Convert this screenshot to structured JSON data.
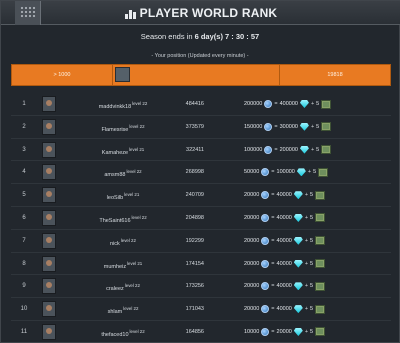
{
  "title": "PLAYER WORLD RANK",
  "season": {
    "prefix": "Season ends in",
    "countdown": "6 day(s) 7 : 30 : 57"
  },
  "position_note": "- Your position (Updated every minute) -",
  "my_entry": {
    "rank": "> 1000",
    "score": "19818"
  },
  "players": [
    {
      "rank": "1",
      "name": "maddvinkk18",
      "level": "level 22",
      "points": "484416",
      "silver": "200000",
      "gems": "400000",
      "crates": "5"
    },
    {
      "rank": "2",
      "name": "Flamesrise",
      "level": "level 22",
      "points": "373579",
      "silver": "150000",
      "gems": "300000",
      "crates": "5"
    },
    {
      "rank": "3",
      "name": "Kamaheze",
      "level": "level 21",
      "points": "322411",
      "silver": "100000",
      "gems": "200000",
      "crates": "5"
    },
    {
      "rank": "4",
      "name": "amsm88",
      "level": "level 22",
      "points": "268998",
      "silver": "50000",
      "gems": "100000",
      "crates": "5"
    },
    {
      "rank": "5",
      "name": "leoSilb",
      "level": "level 21",
      "points": "240709",
      "silver": "20000",
      "gems": "40000",
      "crates": "5"
    },
    {
      "rank": "6",
      "name": "TheSaint616",
      "level": "level 22",
      "points": "204898",
      "silver": "20000",
      "gems": "40000",
      "crates": "5"
    },
    {
      "rank": "7",
      "name": "nick",
      "level": "level 22",
      "points": "192299",
      "silver": "20000",
      "gems": "40000",
      "crates": "5"
    },
    {
      "rank": "8",
      "name": "mumheiz",
      "level": "level 21",
      "points": "174154",
      "silver": "20000",
      "gems": "40000",
      "crates": "5"
    },
    {
      "rank": "9",
      "name": "craleez",
      "level": "level 22",
      "points": "173256",
      "silver": "20000",
      "gems": "40000",
      "crates": "5"
    },
    {
      "rank": "10",
      "name": "shlam",
      "level": "level 22",
      "points": "171043",
      "silver": "20000",
      "gems": "40000",
      "crates": "5"
    },
    {
      "rank": "11",
      "name": "thefaced10",
      "level": "level 22",
      "points": "164856",
      "silver": "10000",
      "gems": "20000",
      "crates": "5"
    }
  ],
  "icons": {
    "title": "rank-bars-icon",
    "silver": "silver-coin-icon",
    "gem": "gem-icon",
    "crate": "crate-icon"
  },
  "colors": {
    "accent": "#e87a22",
    "background": "#22272d"
  }
}
